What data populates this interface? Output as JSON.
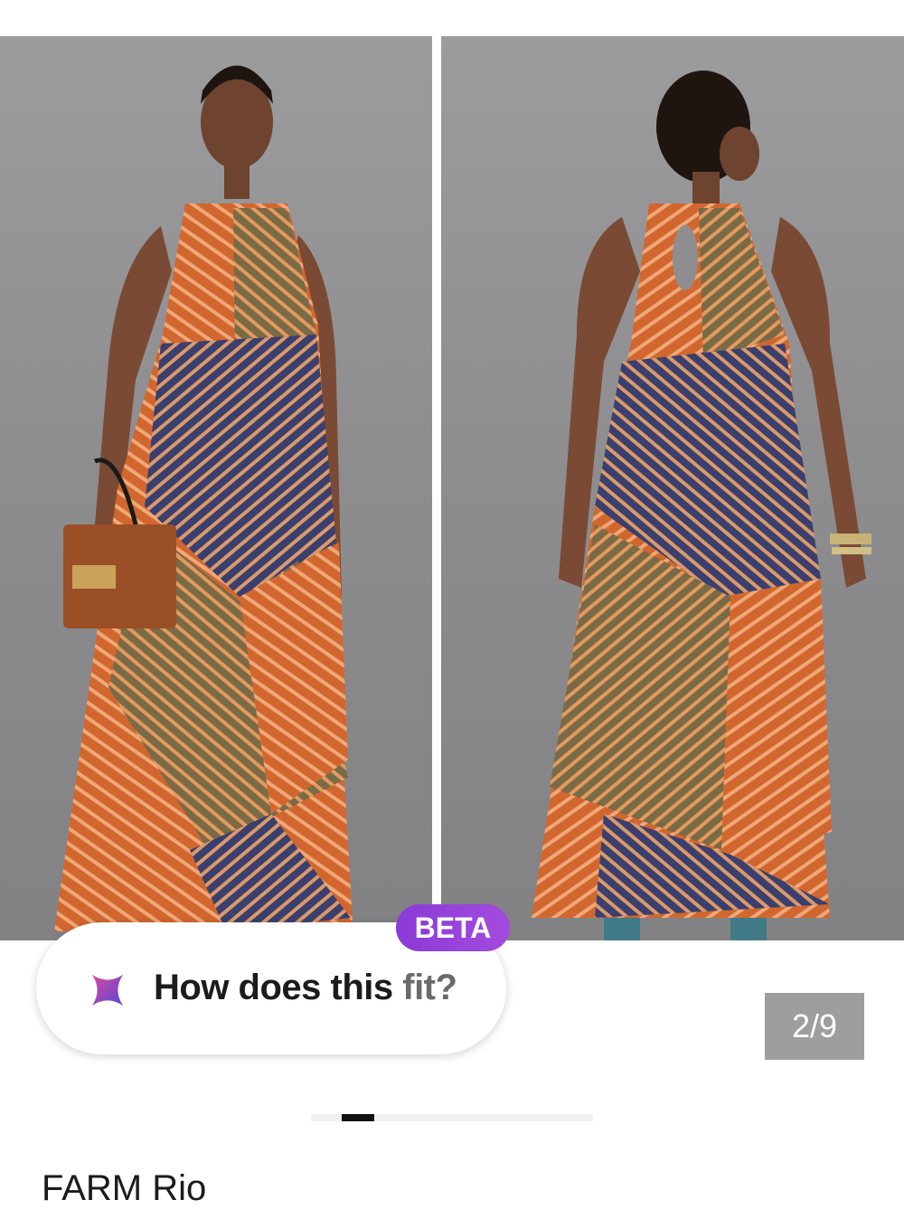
{
  "gallery": {
    "images": [
      {
        "icon": "dress-front-photo"
      },
      {
        "icon": "dress-back-photo"
      }
    ],
    "counter": "2/9",
    "pagination": {
      "active_index": 1,
      "total": 9
    }
  },
  "fit_widget": {
    "badge": "BETA",
    "label_main": "How does this ",
    "label_fade": "fit?",
    "icon": "sparkle-icon",
    "gradient_colors": [
      "#d84a9a",
      "#5a46d8"
    ]
  },
  "product": {
    "brand": "FARM Rio"
  },
  "colors": {
    "badge": "#9a42db",
    "counter_bg": "#9e9e9e",
    "dress_orange": "#d1672e",
    "dress_navy": "#3b3f6e",
    "dress_olive": "#7b6a46"
  }
}
